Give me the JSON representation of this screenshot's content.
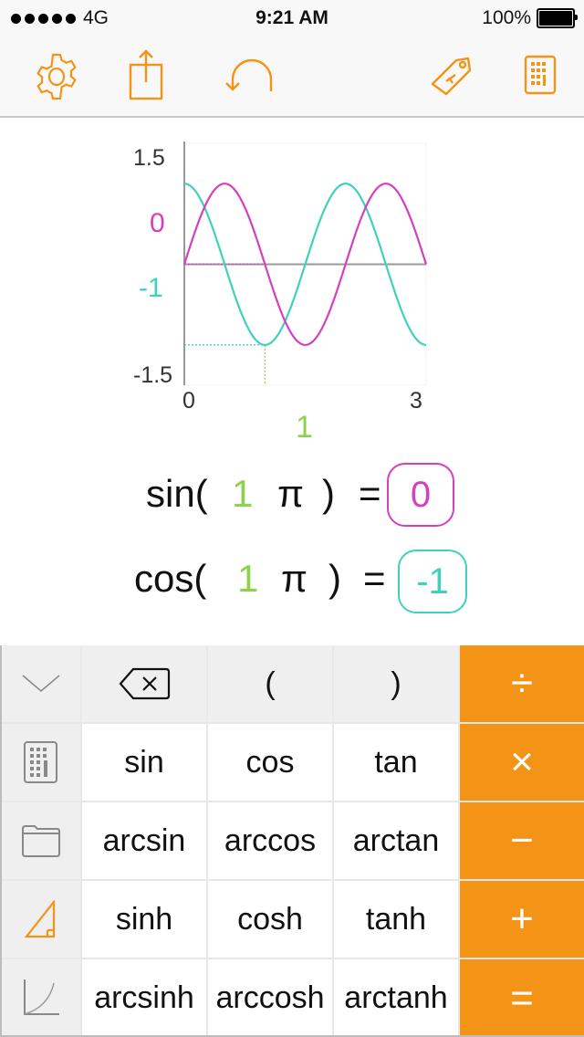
{
  "status_bar": {
    "signal_dots": 5,
    "carrier": "4G",
    "time": "9:21 AM",
    "battery": "100%",
    "battery_level": 1.0
  },
  "toolbar": {
    "buttons": [
      {
        "name": "settings",
        "icon": "gear-icon"
      },
      {
        "name": "share",
        "icon": "share-icon"
      },
      {
        "name": "undo",
        "icon": "undo-icon"
      },
      {
        "name": "tag",
        "icon": "tag-icon"
      },
      {
        "name": "calculator",
        "icon": "calculator-icon"
      }
    ],
    "accent_color": "#f39416"
  },
  "chart_data": {
    "type": "line",
    "x_unit": "π",
    "xlim": [
      0,
      3
    ],
    "ylim": [
      -1.5,
      1.5
    ],
    "x_tick_labels": [
      "0",
      "3"
    ],
    "y_tick_labels": [
      "1.5",
      "-1.5"
    ],
    "cursor": {
      "x": 1,
      "x_label": "1",
      "sin_value": 0,
      "sin_label": "0",
      "cos_value": -1,
      "cos_label": "-1"
    },
    "series": [
      {
        "name": "sin",
        "function": "sin(πx)",
        "color": "#d63fbf"
      },
      {
        "name": "cos",
        "function": "cos(πx)",
        "color": "#3ed1bf"
      }
    ],
    "cursor_color": "#8fd14f",
    "grid": false
  },
  "formulas": [
    {
      "func": "sin(",
      "arg": "1",
      "unit": "π",
      "close": ")",
      "eq": "=",
      "result": "0",
      "color": "#d63fbf"
    },
    {
      "func": "cos(",
      "arg": "1",
      "unit": "π",
      "close": ")",
      "eq": "=",
      "result": "-1",
      "color": "#3ed1bf"
    }
  ],
  "keypad": {
    "side": [
      {
        "name": "collapse",
        "icon": "chevron-down-icon"
      },
      {
        "name": "calculator-mode",
        "icon": "calculator-icon"
      },
      {
        "name": "files",
        "icon": "folder-icon"
      },
      {
        "name": "trig-mode",
        "icon": "triangle-icon",
        "active": true
      },
      {
        "name": "functions-mode",
        "icon": "graph-icon"
      }
    ],
    "top_row": [
      {
        "name": "backspace",
        "icon": "backspace-icon",
        "label": ""
      },
      {
        "name": "open-paren",
        "label": "("
      },
      {
        "name": "close-paren",
        "label": ")"
      }
    ],
    "function_rows": [
      [
        "sin",
        "cos",
        "tan"
      ],
      [
        "arcsin",
        "arccos",
        "arctan"
      ],
      [
        "sinh",
        "cosh",
        "tanh"
      ],
      [
        "arcsinh",
        "arccosh",
        "arctanh"
      ]
    ],
    "operators": [
      {
        "name": "divide",
        "label": "÷"
      },
      {
        "name": "multiply",
        "label": "×"
      },
      {
        "name": "subtract",
        "label": "−"
      },
      {
        "name": "add",
        "label": "+"
      },
      {
        "name": "equals",
        "label": "="
      }
    ]
  }
}
